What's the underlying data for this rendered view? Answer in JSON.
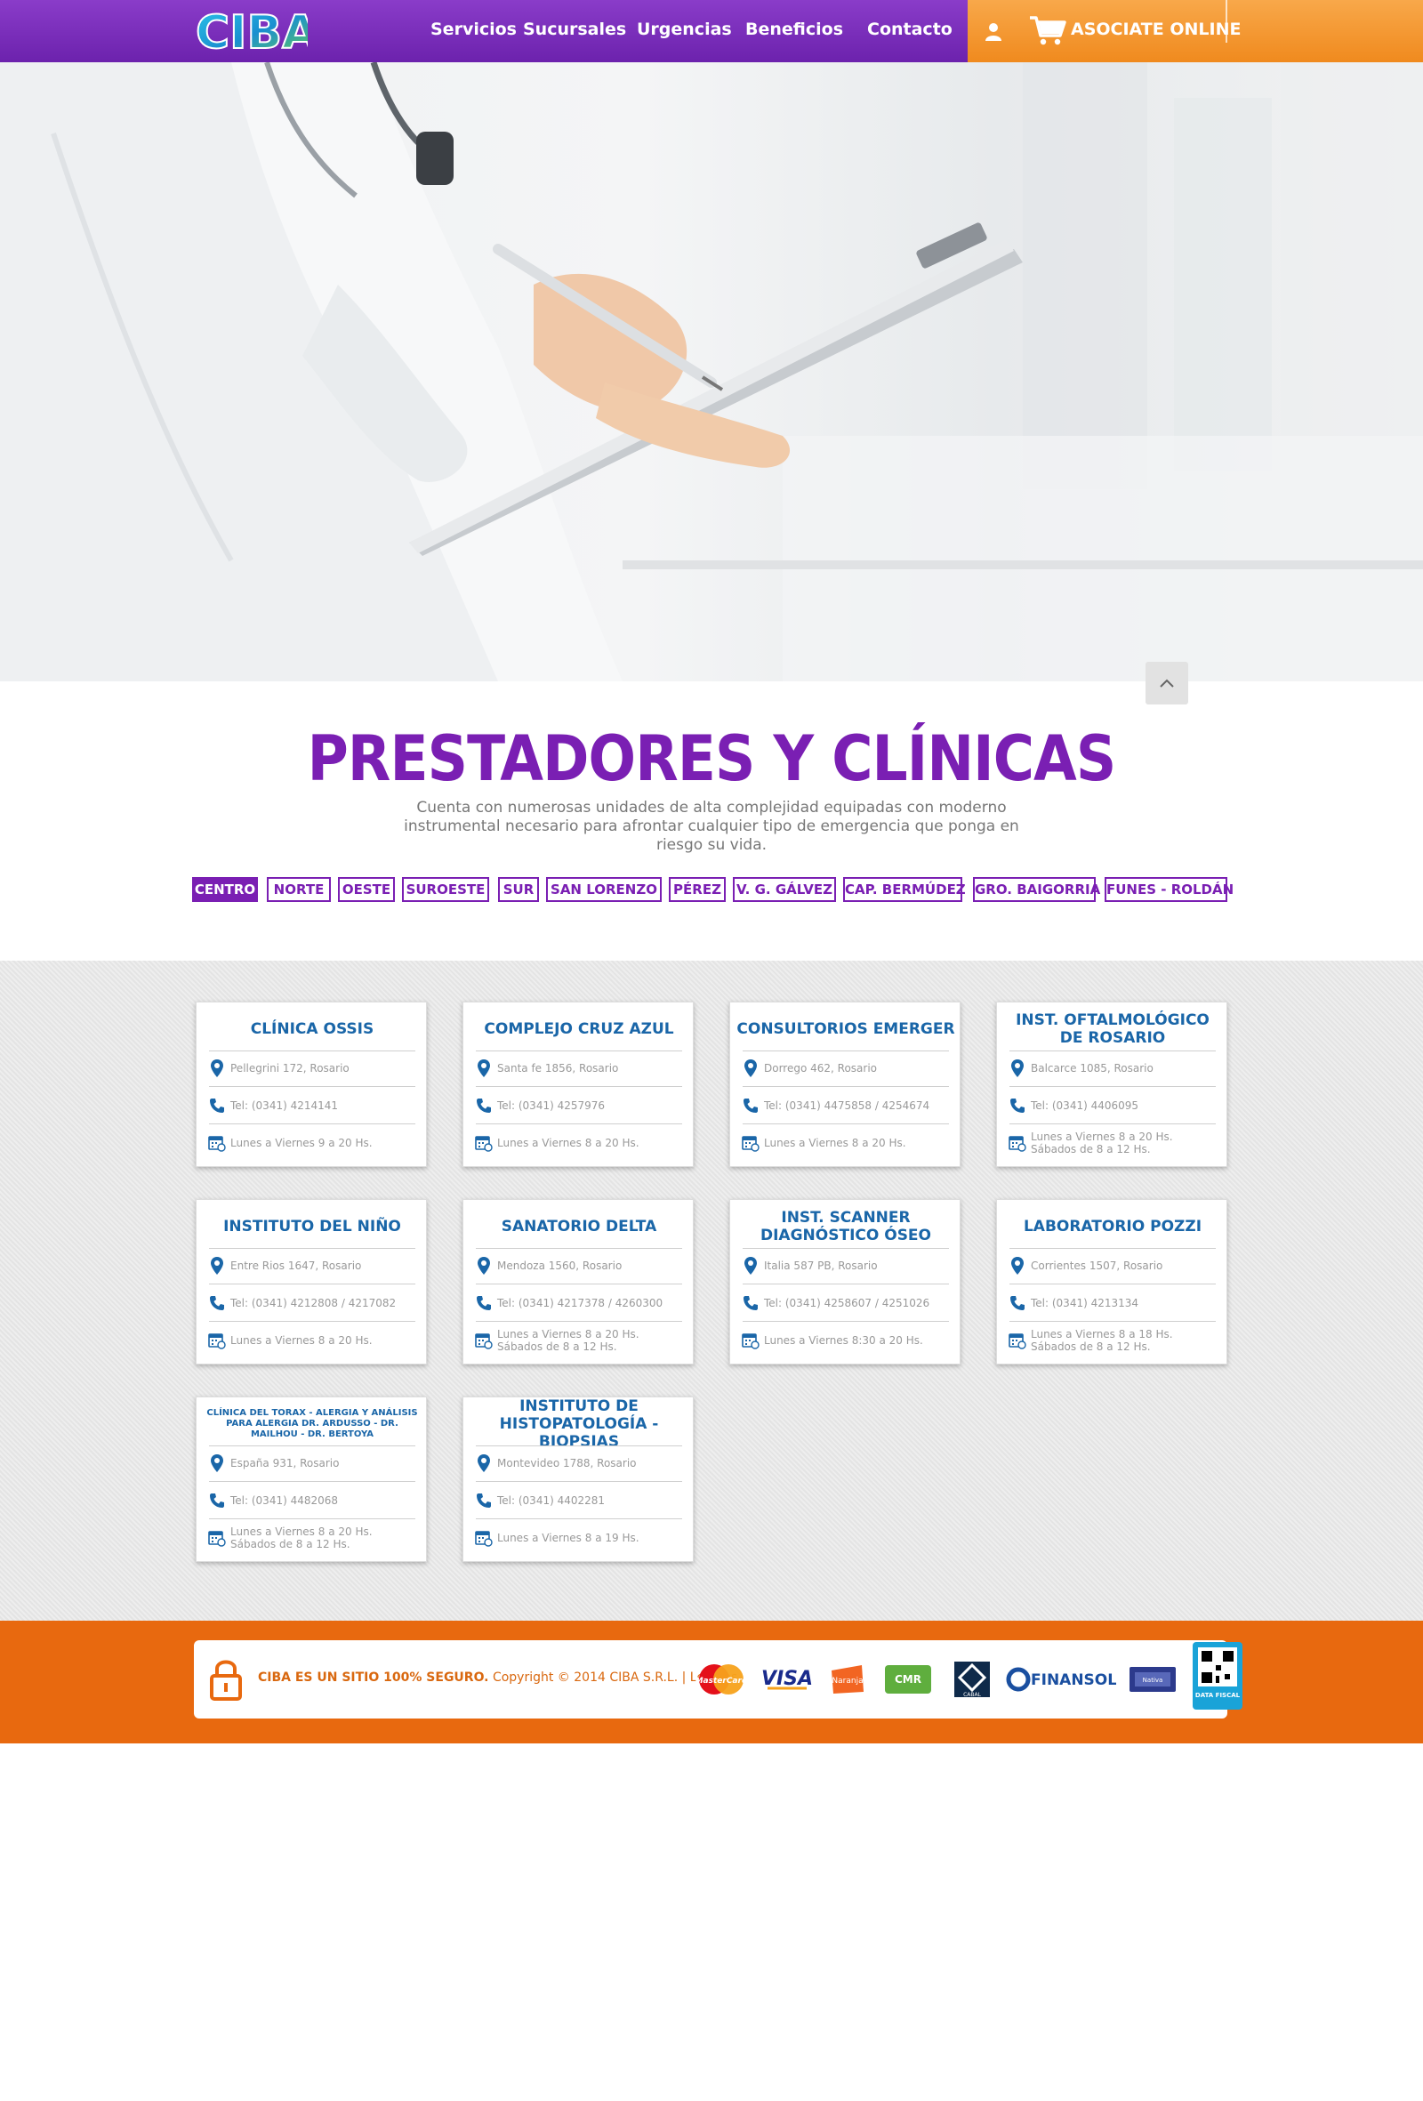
{
  "header": {
    "logo_text": "CIBA",
    "nav": [
      "Servicios",
      "Sucursales",
      "Urgencias",
      "Beneficios",
      "Contacto"
    ],
    "cta_label": "ASOCIATE ONLINE"
  },
  "section": {
    "title": "PRESTADORES Y CLÍNICAS",
    "subtitle": "Cuenta con numerosas unidades de alta complejidad equipadas con moderno instrumental necesario para afrontar cualquier tipo de emergencia que ponga en riesgo su vida."
  },
  "tabs": [
    "CENTRO",
    "NORTE",
    "OESTE",
    "SUROESTE",
    "SUR",
    "SAN LORENZO",
    "PÉREZ",
    "V. G. GÁLVEZ",
    "CAP. BERMÚDEZ",
    "GRO. BAIGORRIA",
    "FUNES - ROLDÁN"
  ],
  "active_tab": "CENTRO",
  "providers": [
    {
      "name": "CLÍNICA OSSIS",
      "address": "Pellegrini 172, Rosario",
      "phone": "Tel: (0341) 4214141",
      "hours": "Lunes a Viernes 9 a 20 Hs.",
      "hours2": ""
    },
    {
      "name": "COMPLEJO CRUZ AZUL",
      "address": "Santa fe 1856, Rosario",
      "phone": "Tel: (0341) 4257976",
      "hours": "Lunes a Viernes 8 a 20 Hs.",
      "hours2": ""
    },
    {
      "name": "CONSULTORIOS EMERGER",
      "address": "Dorrego 462, Rosario",
      "phone": "Tel: (0341) 4475858 / 4254674",
      "hours": "Lunes a Viernes 8 a 20 Hs.",
      "hours2": ""
    },
    {
      "name": "INST. OFTALMOLÓGICO DE ROSARIO",
      "address": "Balcarce 1085, Rosario",
      "phone": "Tel: (0341) 4406095",
      "hours": "Lunes a Viernes 8 a 20 Hs.",
      "hours2": "Sábados de 8 a 12 Hs."
    },
    {
      "name": "INSTITUTO DEL NIÑO",
      "address": "Entre Rios 1647, Rosario",
      "phone": "Tel: (0341) 4212808 / 4217082",
      "hours": "Lunes a Viernes 8 a 20 Hs.",
      "hours2": ""
    },
    {
      "name": "SANATORIO DELTA",
      "address": "Mendoza 1560, Rosario",
      "phone": "Tel: (0341) 4217378 / 4260300",
      "hours": "Lunes a Viernes 8 a 20 Hs.",
      "hours2": "Sábados de 8 a 12 Hs."
    },
    {
      "name": "INST. SCANNER DIAGNÓSTICO ÓSEO",
      "address": "Italia 587 PB, Rosario",
      "phone": "Tel: (0341) 4258607 / 4251026",
      "hours": "Lunes a Viernes 8:30 a 20 Hs.",
      "hours2": ""
    },
    {
      "name": "LABORATORIO POZZI",
      "address": "Corrientes 1507, Rosario",
      "phone": "Tel: (0341) 4213134",
      "hours": "Lunes a Viernes 8 a 18 Hs.",
      "hours2": "Sábados de 8 a 12 Hs."
    },
    {
      "name": "CLÍNICA DEL TORAX - ALERGIA Y ANÁLISIS PARA ALERGIA DR. ARDUSSO - DR. MAILHOU - DR. BERTOYA",
      "address": "España 931, Rosario",
      "phone": "Tel: (0341) 4482068",
      "hours": "Lunes a Viernes 8 a 20 Hs.",
      "hours2": "Sábados de 8 a 12 Hs."
    },
    {
      "name": "INSTITUTO DE HISTOPATOLOGÍA - BIOPSIAS",
      "address": "Montevideo 1788, Rosario",
      "phone": "Tel: (0341) 4402281",
      "hours": "Lunes a Viernes 8 a 19 Hs.",
      "hours2": ""
    }
  ],
  "footer": {
    "secure_label": "CIBA ES UN SITIO 100% SEGURO.",
    "copyright": "Copyright © 2014 CIBA S.R.L. |",
    "legal_link": "Legales",
    "payment_methods": [
      "MasterCard",
      "VISA",
      "Naranja",
      "CMR",
      "CABAL",
      "FINANSOL",
      "Nativa",
      "DATA FISCAL"
    ]
  },
  "colors": {
    "purple": "#7a1fb3",
    "orange": "#e8690f",
    "blue": "#1a66a8"
  }
}
